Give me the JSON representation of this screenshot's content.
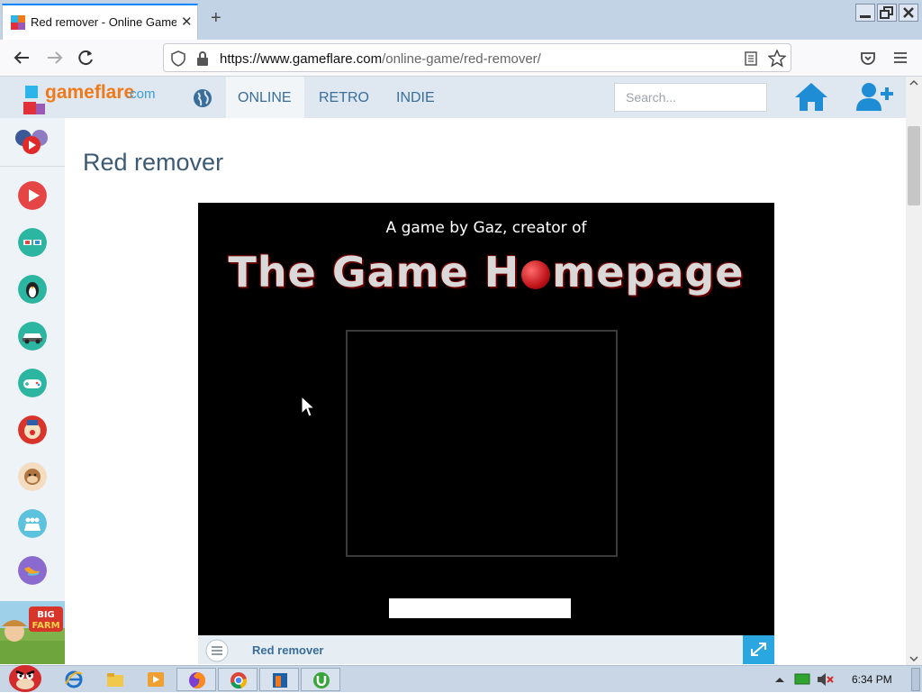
{
  "browser": {
    "tab_title": "Red remover - Online Game",
    "tab_close": "✕",
    "new_tab": "+",
    "url_domain": "https://www.gameflare.com",
    "url_path": "/online-game/red-remover/"
  },
  "site": {
    "logo_text": "gameflare",
    "logo_com": ".com",
    "menu": [
      "ONLINE",
      "RETRO",
      "INDIE"
    ],
    "search_placeholder": "Search..."
  },
  "page": {
    "title": "Red remover"
  },
  "game": {
    "byline": "A game by Gaz, creator of",
    "title_left": "The Game H",
    "title_right": "mepage",
    "footer_name": "Red remover"
  },
  "taskbar": {
    "clock": "6:34 PM"
  },
  "colors": {
    "accent": "#3a6e9a",
    "header_bg": "#dfe8f0",
    "fullscreen_btn": "#2aa6e0",
    "logo_orange": "#f07a1a"
  },
  "sidebar_icons": [
    "social-icon",
    "play-icon",
    "3d-glasses-icon",
    "penguin-icon",
    "car-icon",
    "gamepad-icon",
    "clown-icon",
    "monkey-icon",
    "crowd-icon",
    "bird-icon",
    "big-farm-ad"
  ]
}
